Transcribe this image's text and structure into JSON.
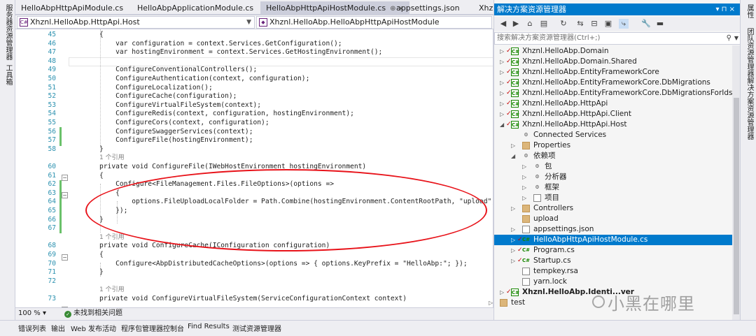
{
  "left_strip": {
    "items": [
      "服务器资源管理器",
      "工具箱"
    ]
  },
  "tabs": [
    {
      "label": "HelloAbpHttpApiModule.cs",
      "active": false
    },
    {
      "label": "HelloAbpApplicationModule.cs",
      "active": false
    },
    {
      "label": "HelloAbpHttpApiHostModule.cs",
      "active": true,
      "pin": "⊕ ×"
    },
    {
      "label": "appsettings.json",
      "active": false
    },
    {
      "label": "Xhzn",
      "active": false
    }
  ],
  "navbar": {
    "project_combo": "Xhznl.HelloAbp.HttpApi.Host",
    "class_combo": "Xhznl.HelloAbp.HelloAbpHttpApiHostModule"
  },
  "editor": {
    "lines": [
      {
        "n": "45",
        "t": "{"
      },
      {
        "n": "46",
        "t": "    var configuration = context.Services.GetConfiguration();"
      },
      {
        "n": "47",
        "t": "    var hostingEnvironment = context.Services.GetHostingEnvironment();"
      },
      {
        "n": "48",
        "t": ""
      },
      {
        "n": "49",
        "t": "    ConfigureConventionalControllers();"
      },
      {
        "n": "50",
        "t": "    ConfigureAuthentication(context, configuration);"
      },
      {
        "n": "51",
        "t": "    ConfigureLocalization();"
      },
      {
        "n": "52",
        "t": "    ConfigureCache(configuration);"
      },
      {
        "n": "53",
        "t": "    ConfigureVirtualFileSystem(context);"
      },
      {
        "n": "54",
        "t": "    ConfigureRedis(context, configuration, hostingEnvironment);"
      },
      {
        "n": "55",
        "t": "    ConfigureCors(context, configuration);"
      },
      {
        "n": "56",
        "t": "    ConfigureSwaggerServices(context);"
      },
      {
        "n": "57",
        "t": "    ConfigureFile(hostingEnvironment);"
      },
      {
        "n": "58",
        "t": "}"
      },
      {
        "n": "",
        "t": "1 个引用"
      },
      {
        "n": "60",
        "t": "private void ConfigureFile(IWebHostEnvironment hostingEnvironment)"
      },
      {
        "n": "61",
        "t": "{"
      },
      {
        "n": "62",
        "t": "    Configure<FileManagement.Files.FileOptions>(options =>"
      },
      {
        "n": "63",
        "t": "    {"
      },
      {
        "n": "64",
        "t": "        options.FileUploadLocalFolder = Path.Combine(hostingEnvironment.ContentRootPath, \"upload\");"
      },
      {
        "n": "65",
        "t": "    });"
      },
      {
        "n": "66",
        "t": "}"
      },
      {
        "n": "67",
        "t": ""
      },
      {
        "n": "",
        "t": "1 个引用"
      },
      {
        "n": "68",
        "t": "private void ConfigureCache(IConfiguration configuration)"
      },
      {
        "n": "69",
        "t": "{"
      },
      {
        "n": "70",
        "t": "    Configure<AbpDistributedCacheOptions>(options => { options.KeyPrefix = \"HelloAbp:\"; });"
      },
      {
        "n": "71",
        "t": "}"
      },
      {
        "n": "72",
        "t": ""
      },
      {
        "n": "",
        "t": "1 个引用"
      },
      {
        "n": "73",
        "t": "private void ConfigureVirtualFileSystem(ServiceConfigurationContext context)"
      }
    ]
  },
  "status": {
    "zoom": "100 %",
    "issues": "未找到相关问题"
  },
  "bottom_tabs": [
    "错误列表",
    "输出",
    "Web 发布活动",
    "程序包管理器控制台",
    "Find Results",
    "测试资源管理器"
  ],
  "solution_explorer": {
    "title": "解决方案资源管理器",
    "window_buttons": "▾ ⊓ ×",
    "search_placeholder": "搜索解决方案资源管理器(Ctrl+;)",
    "nodes": [
      {
        "label": "Xhznl.HelloAbp.Domain",
        "kind": "proj",
        "depth": 0,
        "expand": "▷"
      },
      {
        "label": "Xhznl.HelloAbp.Domain.Shared",
        "kind": "proj",
        "depth": 0,
        "expand": "▷"
      },
      {
        "label": "Xhznl.HelloAbp.EntityFrameworkCore",
        "kind": "proj",
        "depth": 0,
        "expand": "▷"
      },
      {
        "label": "Xhznl.HelloAbp.EntityFrameworkCore.DbMigrations",
        "kind": "proj",
        "depth": 0,
        "expand": "▷"
      },
      {
        "label": "Xhznl.HelloAbp.EntityFrameworkCore.DbMigrationsForIds",
        "kind": "proj",
        "depth": 0,
        "expand": "▷"
      },
      {
        "label": "Xhznl.HelloAbp.HttpApi",
        "kind": "proj",
        "depth": 0,
        "expand": "▷"
      },
      {
        "label": "Xhznl.HelloAbp.HttpApi.Client",
        "kind": "proj",
        "depth": 0,
        "expand": "▷"
      },
      {
        "label": "Xhznl.HelloAbp.HttpApi.Host",
        "kind": "proj",
        "depth": 0,
        "expand": "◢"
      },
      {
        "label": "Connected Services",
        "kind": "gear",
        "depth": 1,
        "expand": ""
      },
      {
        "label": "Properties",
        "kind": "folder",
        "depth": 1,
        "expand": "▷"
      },
      {
        "label": "依赖项",
        "kind": "gear",
        "depth": 1,
        "expand": "◢"
      },
      {
        "label": "包",
        "kind": "gear",
        "depth": 2,
        "expand": "▷"
      },
      {
        "label": "分析器",
        "kind": "gear",
        "depth": 2,
        "expand": "▷"
      },
      {
        "label": "框架",
        "kind": "gear",
        "depth": 2,
        "expand": "▷"
      },
      {
        "label": "项目",
        "kind": "file",
        "depth": 2,
        "expand": "▷"
      },
      {
        "label": "Controllers",
        "kind": "folder",
        "depth": 1,
        "expand": "▷"
      },
      {
        "label": "upload",
        "kind": "folder",
        "depth": 1,
        "expand": ""
      },
      {
        "label": "appsettings.json",
        "kind": "file",
        "depth": 1,
        "expand": "▷"
      },
      {
        "label": "HelloAbpHttpApiHostModule.cs",
        "kind": "cs",
        "depth": 1,
        "expand": "▷",
        "selected": true
      },
      {
        "label": "Program.cs",
        "kind": "cs",
        "depth": 1,
        "expand": "▷"
      },
      {
        "label": "Startup.cs",
        "kind": "cs",
        "depth": 1,
        "expand": "▷"
      },
      {
        "label": "tempkey.rsa",
        "kind": "file",
        "depth": 1,
        "expand": ""
      },
      {
        "label": "yarn.lock",
        "kind": "file",
        "depth": 1,
        "expand": ""
      },
      {
        "label": "Xhznl.HelloAbp.Identi...ver",
        "kind": "proj",
        "depth": 0,
        "expand": "▷"
      },
      {
        "label": "test",
        "kind": "folder",
        "depth": -1,
        "expand": "▷"
      }
    ]
  },
  "right_strip": {
    "items": [
      "属性",
      "团队资源管理器",
      "解决方案资源管理器"
    ]
  },
  "watermark": "小黑在哪里",
  "colors": {
    "accent": "#007acc",
    "keyword": "#0000ff",
    "type": "#2b91af",
    "string": "#a31515",
    "annotation": "#e8131a"
  }
}
